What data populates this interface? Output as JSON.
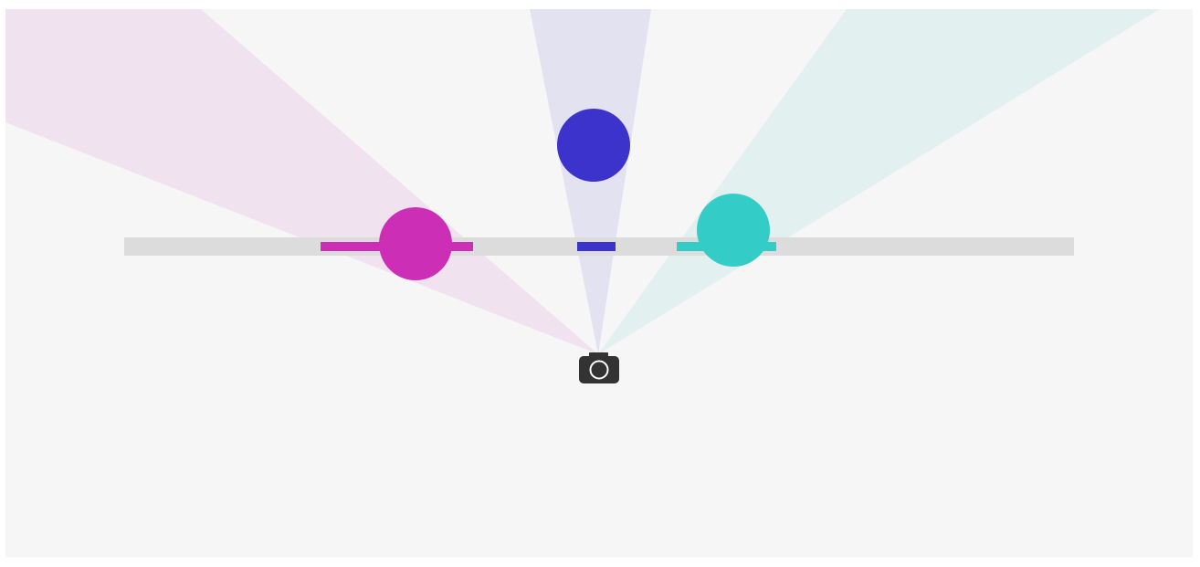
{
  "scene": {
    "background_color": "#f6f6f6",
    "canvas_border_color": "#ffffff",
    "screen_color": "#dcdcdc",
    "camera_color": "#333333",
    "camera_lens_color": "#ffffff",
    "camera_icon": "camera-icon"
  },
  "objects": [
    {
      "name": "magenta",
      "color": "#cc2eb5",
      "cone_color": "#f0e2ef"
    },
    {
      "name": "blue",
      "color": "#3c33cc",
      "cone_color": "#e3e2f0"
    },
    {
      "name": "teal",
      "color": "#33ccc7",
      "cone_color": "#e2f0f0"
    }
  ]
}
